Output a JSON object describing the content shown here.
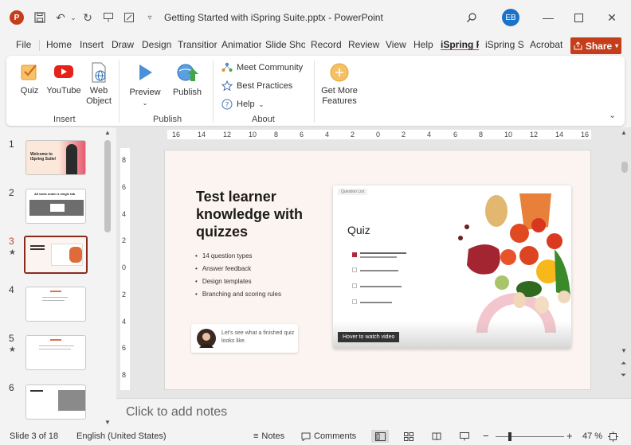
{
  "titlebar": {
    "app_logo": "P",
    "doc_title": "Getting Started with iSpring Suite.pptx  -  PowerPoint",
    "user_initials": "EB",
    "icons": [
      "save-icon",
      "undo-icon",
      "redo-icon",
      "present-icon",
      "customize-icon",
      "search-icon",
      "minimize-icon",
      "maximize-icon",
      "close-icon"
    ]
  },
  "tabs": [
    "File",
    "Home",
    "Insert",
    "Draw",
    "Design",
    "Transitior",
    "Animatior",
    "Slide Sho",
    "Record",
    "Review",
    "View",
    "Help",
    "iSpring F",
    "iSpring S",
    "Acrobat"
  ],
  "active_tab": "iSpring F",
  "share_label": "Share",
  "ribbon": {
    "insert_group": {
      "label": "Insert",
      "quiz": "Quiz",
      "youtube": "YouTube",
      "web_object_1": "Web",
      "web_object_2": "Object"
    },
    "publish_group": {
      "label": "Publish",
      "preview": "Preview",
      "publish": "Publish"
    },
    "about_group": {
      "label": "About",
      "meet": "Meet Community",
      "best": "Best Practices",
      "help": "Help"
    },
    "features": {
      "line1": "Get More",
      "line2": "Features"
    }
  },
  "ruler": {
    "h_labels": [
      "16",
      "14",
      "12",
      "10",
      "8",
      "6",
      "4",
      "2",
      "0",
      "2",
      "4",
      "6",
      "8",
      "10",
      "12",
      "14",
      "16"
    ],
    "v_labels": [
      "8",
      "6",
      "4",
      "2",
      "0",
      "2",
      "4",
      "6",
      "8"
    ]
  },
  "slides_panel": {
    "numbers": [
      "1",
      "2",
      "3",
      "4",
      "5",
      "6"
    ],
    "selected_index": 2,
    "thumb1_title": "Welcome to iSpring Suite!",
    "thumb2_title": "All tools under a single tab"
  },
  "slide": {
    "title": "Test learner knowledge with quizzes",
    "bullets": [
      "14 question types",
      "Answer feedback",
      "Design templates",
      "Branching and scoring rules"
    ],
    "bubble_text": "Let's see what a finished quiz looks like.",
    "card_tag": "Question List",
    "card_title": "Quiz",
    "hover_label": "Hover to watch video"
  },
  "notes_placeholder": "Click to add notes",
  "statusbar": {
    "slide_count": "Slide 3 of 18",
    "language": "English (United States)",
    "notes": "Notes",
    "comments": "Comments",
    "zoom": "47 %",
    "zoom_level_percent": 47
  },
  "colors": {
    "accent": "#c43e1c",
    "slide_bg": "#fbf4f0",
    "user_avatar": "#1a73c8"
  }
}
